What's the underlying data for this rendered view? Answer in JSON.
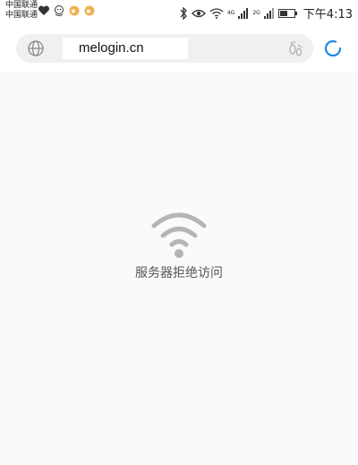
{
  "status_bar": {
    "carrier_line1": "中国联通",
    "carrier_line2": "中国联通",
    "time": "下午4:13",
    "signal_label_1": "4G",
    "signal_label_2": "2G"
  },
  "address_bar": {
    "url": "melogin.cn"
  },
  "error": {
    "message": "服务器拒绝访问"
  },
  "colors": {
    "accent": "#1e88e5",
    "icon_gray": "#b5b5b5",
    "background": "#fafafa"
  }
}
